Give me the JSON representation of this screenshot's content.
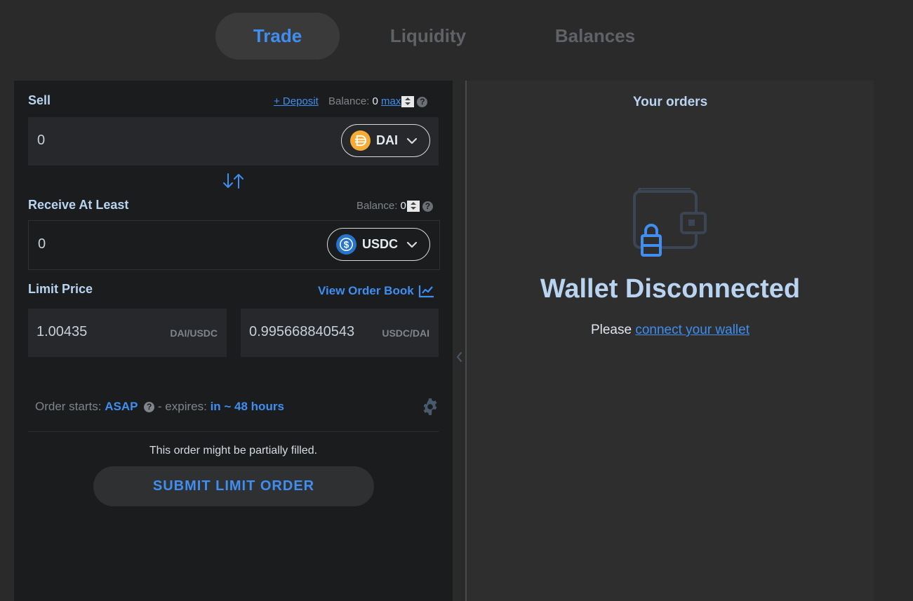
{
  "nav": {
    "tabs": [
      "Trade",
      "Liquidity",
      "Balances"
    ],
    "active": "Trade"
  },
  "sell": {
    "label": "Sell",
    "deposit": "+ Deposit",
    "balance_label": "Balance:",
    "balance_value": "0",
    "max": "max",
    "amount": "0",
    "token": "DAI",
    "token_color": "#f5ac37"
  },
  "receive": {
    "label": "Receive At Least",
    "balance_label": "Balance:",
    "balance_value": "0",
    "amount": "0",
    "token": "USDC",
    "token_color": "#2775ca"
  },
  "limit": {
    "label": "Limit Price",
    "view_order_book": "View Order Book",
    "price1": "1.00435",
    "unit1": "DAI/USDC",
    "price2": "0.995668840543",
    "unit2": "USDC/DAI"
  },
  "order": {
    "starts_label": "Order starts:",
    "starts_value": "ASAP",
    "expires_label": "- expires:",
    "expires_value": "in ~ 48 hours",
    "partial_note": "This order might be partially filled.",
    "submit": "SUBMIT LIMIT ORDER"
  },
  "orders_panel": {
    "title": "Your orders",
    "heading": "Wallet Disconnected",
    "please": "Please",
    "connect": "connect your wallet"
  },
  "colors": {
    "accent": "#3f8ef0",
    "heading": "#b9d4f0"
  }
}
